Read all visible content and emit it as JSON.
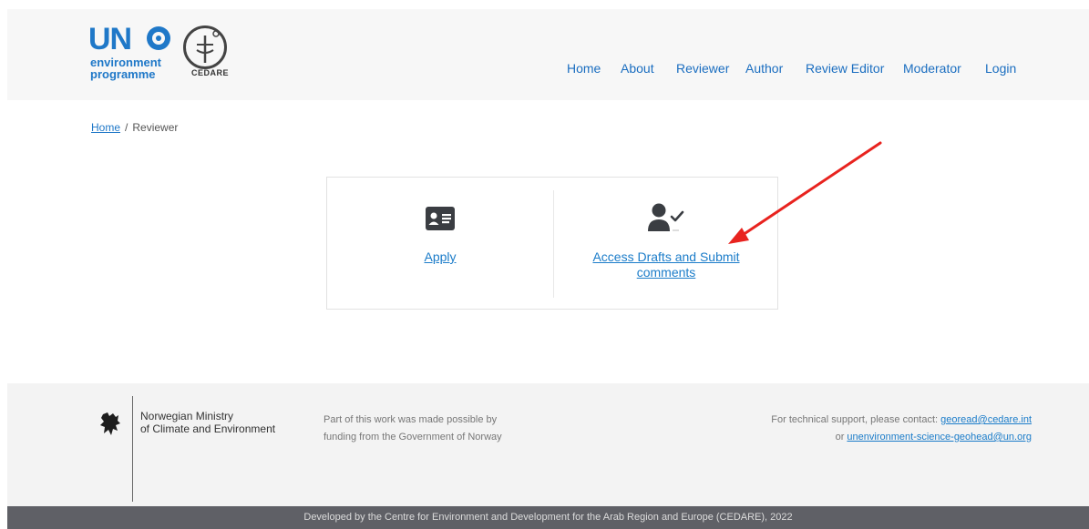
{
  "brand": {
    "un_text": "UN",
    "un_sub_line1": "environment",
    "un_sub_line2": "programme",
    "cedare_text": "CEDARE",
    "un_color": "#1f78c8"
  },
  "nav": {
    "items": [
      {
        "label": "Home"
      },
      {
        "label": "About"
      },
      {
        "label": "Reviewer"
      },
      {
        "label": "Author"
      },
      {
        "label": "Review Editor"
      },
      {
        "label": "Moderator"
      },
      {
        "label": "Login"
      }
    ],
    "color": "#1b6ec0"
  },
  "breadcrumb": {
    "home": "Home",
    "separator": "/",
    "current": "Reviewer"
  },
  "options": {
    "apply": {
      "label": "Apply",
      "icon": "id-card-icon"
    },
    "access": {
      "label_line1": "Access Drafts and Submit",
      "label_line2": "comments",
      "icon": "user-check-icon"
    }
  },
  "annotation": {
    "type": "red-arrow",
    "color": "#e8231f"
  },
  "footer": {
    "ministry_line1": "Norwegian Ministry",
    "ministry_line2": "of Climate and Environment",
    "funding_line1": "Part of this work was made possible by",
    "funding_line2": "funding from the Government of Norway",
    "support_text": "For technical support, please contact:",
    "support_email1": "georead@cedare.int",
    "support_or": "or",
    "support_email2": "unenvironment-science-geohead@un.org"
  },
  "bottom_bar": {
    "text": "Developed by the Centre for Environment and Development for the Arab Region and Europe (CEDARE), 2022"
  }
}
